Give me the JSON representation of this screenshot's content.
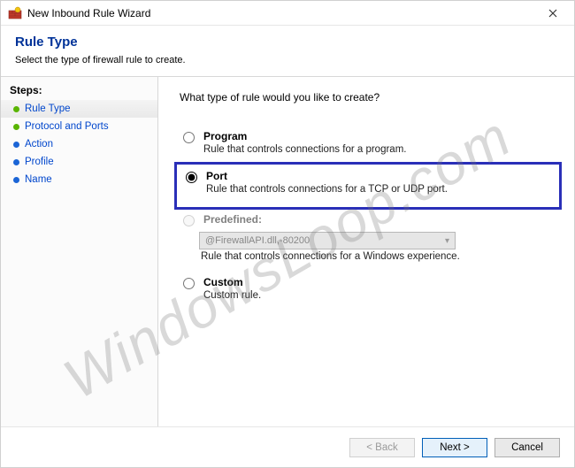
{
  "titlebar": {
    "title": "New Inbound Rule Wizard",
    "icon": "firewall-brick-icon"
  },
  "header": {
    "title": "Rule Type",
    "subtitle": "Select the type of firewall rule to create."
  },
  "sidebar": {
    "label": "Steps:",
    "items": [
      {
        "label": "Rule Type",
        "state": "current"
      },
      {
        "label": "Protocol and Ports",
        "state": "current"
      },
      {
        "label": "Action",
        "state": "pending"
      },
      {
        "label": "Profile",
        "state": "pending"
      },
      {
        "label": "Name",
        "state": "pending"
      }
    ]
  },
  "main": {
    "question": "What type of rule would you like to create?",
    "options": [
      {
        "key": "program",
        "title": "Program",
        "desc": "Rule that controls connections for a program.",
        "selected": false,
        "enabled": true
      },
      {
        "key": "port",
        "title": "Port",
        "desc": "Rule that controls connections for a TCP or UDP port.",
        "selected": true,
        "enabled": true
      },
      {
        "key": "predefined",
        "title": "Predefined:",
        "desc": "Rule that controls connections for a Windows experience.",
        "selected": false,
        "enabled": false,
        "dropdown_value": "@FirewallAPI.dll,-80200"
      },
      {
        "key": "custom",
        "title": "Custom",
        "desc": "Custom rule.",
        "selected": false,
        "enabled": true
      }
    ]
  },
  "footer": {
    "back": "< Back",
    "next": "Next >",
    "cancel": "Cancel"
  },
  "watermark": "WindowsLoop.com"
}
